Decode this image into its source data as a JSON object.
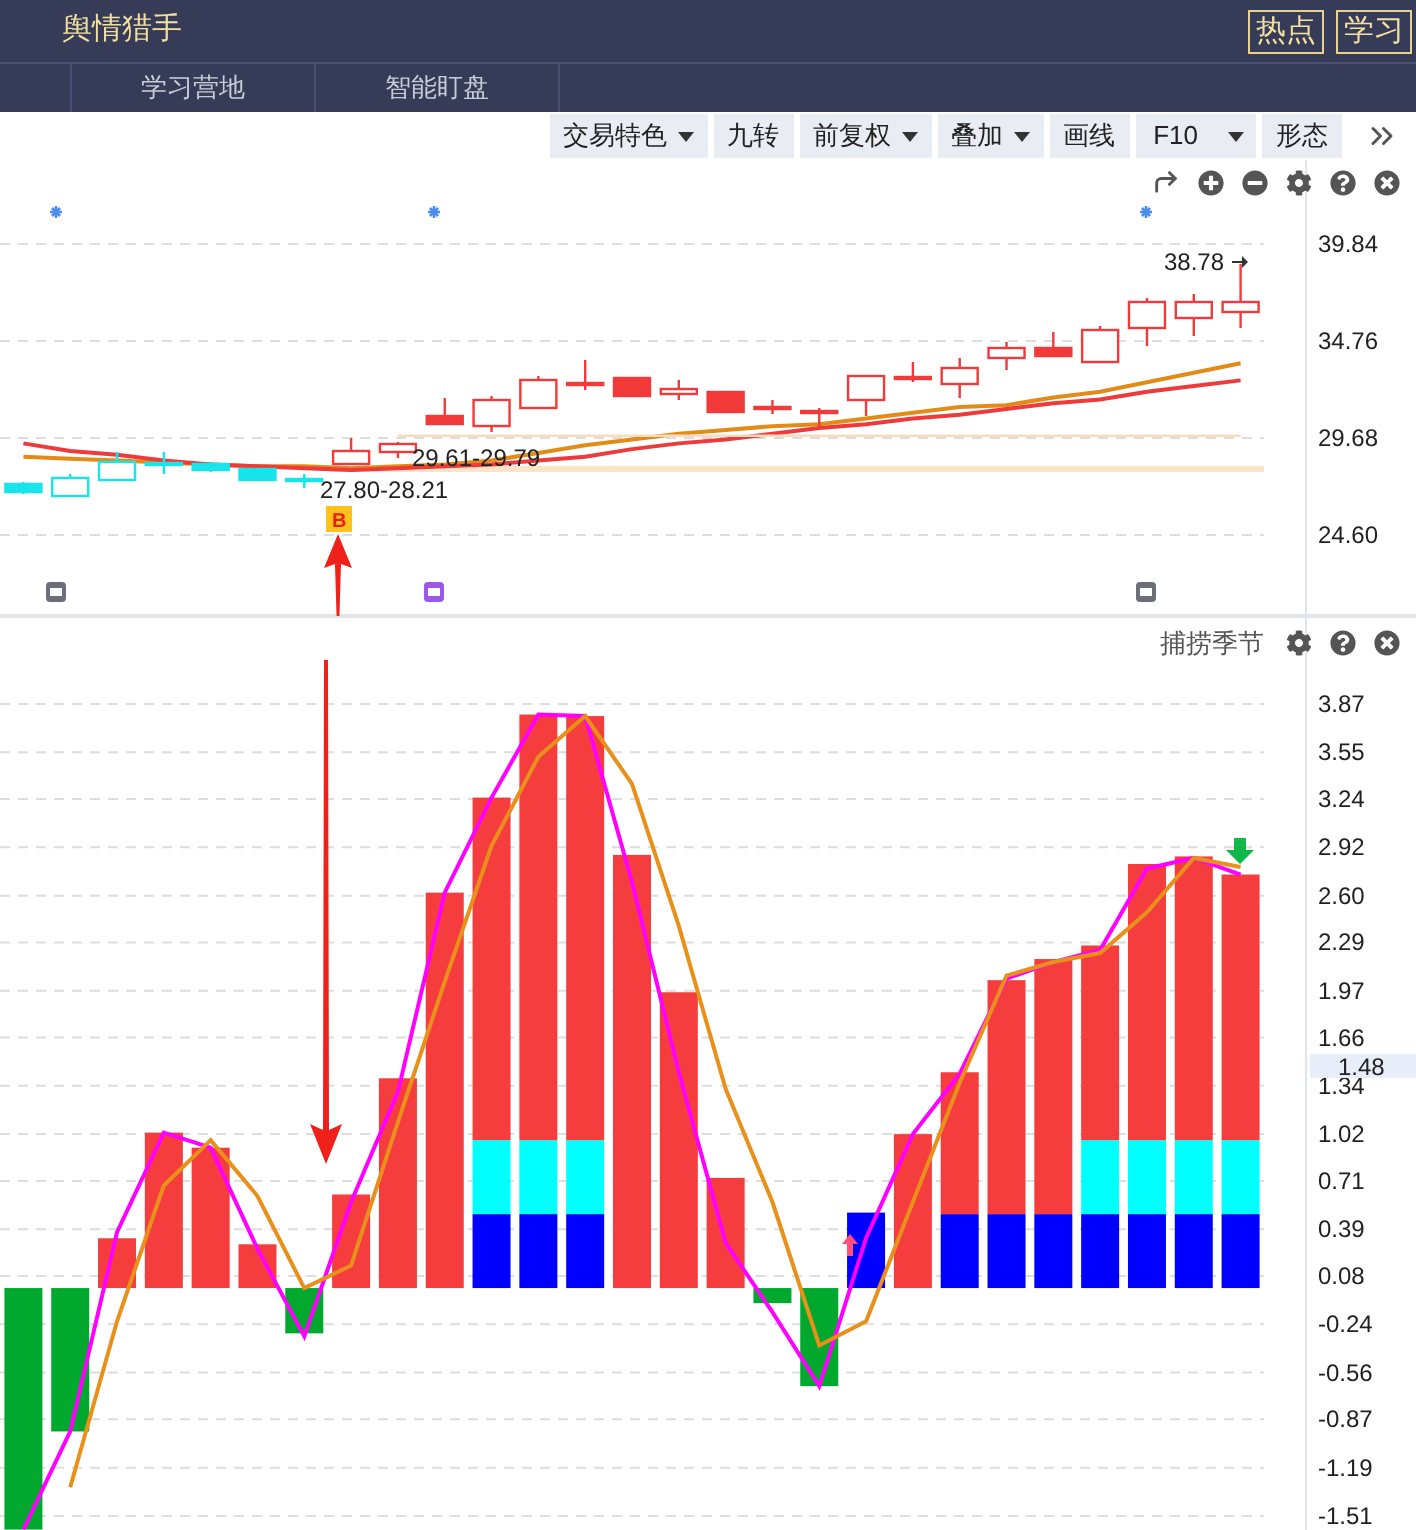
{
  "header": {
    "title": "舆情猎手",
    "buttons": [
      "热点",
      "学习"
    ]
  },
  "nav_tabs": [
    "学习营地",
    "智能盯盘"
  ],
  "toolbar": [
    {
      "label": "交易特色",
      "kind": "dropdown"
    },
    {
      "label": "九转",
      "kind": "plain"
    },
    {
      "label": "前复权",
      "kind": "dropdown"
    },
    {
      "label": "叠加",
      "kind": "dropdown"
    },
    {
      "label": "画线",
      "kind": "plain"
    },
    {
      "label": "F10",
      "kind": "split"
    },
    {
      "label": "形态",
      "kind": "plain"
    }
  ],
  "price_chart": {
    "range_labels": [
      "29.61-29.79",
      "27.80-28.21"
    ],
    "high_label": "38.78",
    "signal": "B",
    "chart_data": {
      "type": "line",
      "grid": true,
      "ylim": [
        20.36,
        44.24
      ],
      "yticks": [
        39.84,
        34.76,
        29.68,
        {
          "value": 24.6,
          "label": "24.60"
        }
      ],
      "series": [
        {
          "color": "#e38b17",
          "values": [
            28.7,
            28.6,
            28.5,
            28.4,
            28.3,
            28.2,
            28.2,
            28.1,
            28.2,
            28.3,
            28.5,
            28.9,
            29.3,
            29.6,
            29.9,
            30.1,
            30.3,
            30.4,
            30.7,
            31.0,
            31.3,
            31.4,
            31.8,
            32.1,
            32.6,
            33.1,
            33.6
          ]
        },
        {
          "color": "#ee3a3a",
          "values": [
            29.4,
            29.0,
            28.8,
            28.5,
            28.3,
            28.2,
            28.1,
            28.0,
            28.1,
            28.2,
            28.3,
            28.5,
            28.7,
            29.1,
            29.4,
            29.6,
            29.9,
            30.2,
            30.4,
            30.7,
            30.9,
            31.2,
            31.5,
            31.7,
            32.1,
            32.4,
            32.7
          ]
        },
        {
          "color": "#f7dcc0",
          "values": [
            null,
            null,
            null,
            null,
            null,
            null,
            null,
            null,
            29.8,
            29.8,
            29.8,
            29.8,
            29.8,
            29.8,
            29.8,
            29.8,
            29.8,
            29.8,
            29.8,
            29.8,
            29.8,
            29.8,
            29.8,
            29.8,
            29.8,
            29.8,
            29.8
          ]
        }
      ]
    }
  },
  "indicator": {
    "title": "捕捞季节",
    "current_value": "1.48",
    "chart_data": {
      "type": "bar",
      "stacked": true,
      "grid": true,
      "ylim": [
        -1.603,
        4.453
      ],
      "yticks": [
        3.87,
        3.55,
        3.24,
        2.92,
        {
          "value": 2.6,
          "label": "2.60"
        },
        2.29,
        1.97,
        1.66,
        1.34,
        1.02,
        0.71,
        0.39,
        0.08,
        -0.24,
        -0.56,
        -0.87,
        -1.19,
        -1.51
      ],
      "series": [
        {
          "color": "#00a82d",
          "values": [
            -1.6,
            -0.95,
            null,
            null,
            null,
            null,
            -0.3,
            null,
            null,
            null,
            null,
            null,
            null,
            null,
            null,
            null,
            -0.1,
            -0.65,
            null,
            null,
            null,
            null,
            null,
            null,
            null,
            null,
            null
          ]
        },
        {
          "color": "#0000ff",
          "values": [
            null,
            null,
            null,
            null,
            null,
            null,
            null,
            null,
            null,
            null,
            0.49,
            0.49,
            0.49,
            null,
            null,
            null,
            null,
            null,
            0.5,
            null,
            0.49,
            0.49,
            0.49,
            0.49,
            0.49,
            0.49,
            0.49
          ]
        },
        {
          "color": "#00ffff",
          "values": [
            null,
            null,
            null,
            null,
            null,
            null,
            null,
            null,
            null,
            null,
            0.49,
            0.49,
            0.49,
            null,
            null,
            null,
            null,
            null,
            null,
            null,
            null,
            null,
            null,
            0.49,
            0.49,
            0.49,
            0.49
          ]
        },
        {
          "color": "#f53d3d",
          "values": [
            null,
            null,
            0.33,
            1.03,
            0.93,
            0.29,
            null,
            0.62,
            1.39,
            2.62,
            2.27,
            2.82,
            2.81,
            2.87,
            1.96,
            0.73,
            null,
            null,
            null,
            1.02,
            0.94,
            1.55,
            1.69,
            1.29,
            1.83,
            1.88,
            1.76
          ]
        },
        {
          "type": "line",
          "color": "#ff00ff",
          "values": [
            -1.6,
            -0.95,
            0.37,
            1.03,
            0.93,
            0.26,
            -0.32,
            0.57,
            1.3,
            2.62,
            3.25,
            3.8,
            3.79,
            2.69,
            1.43,
            0.3,
            -0.16,
            -0.65,
            0.33,
            1.02,
            1.42,
            2.05,
            2.16,
            2.24,
            2.78,
            2.85,
            2.74
          ]
        },
        {
          "type": "line",
          "color": "#e8901a",
          "values": [
            null,
            -1.32,
            -0.22,
            0.68,
            0.98,
            0.61,
            0.0,
            0.15,
            1.1,
            2.03,
            2.93,
            3.52,
            3.79,
            3.34,
            2.4,
            1.32,
            0.57,
            -0.38,
            -0.22,
            0.57,
            1.36,
            2.07,
            2.16,
            2.22,
            2.49,
            2.85,
            2.79
          ]
        }
      ]
    }
  }
}
